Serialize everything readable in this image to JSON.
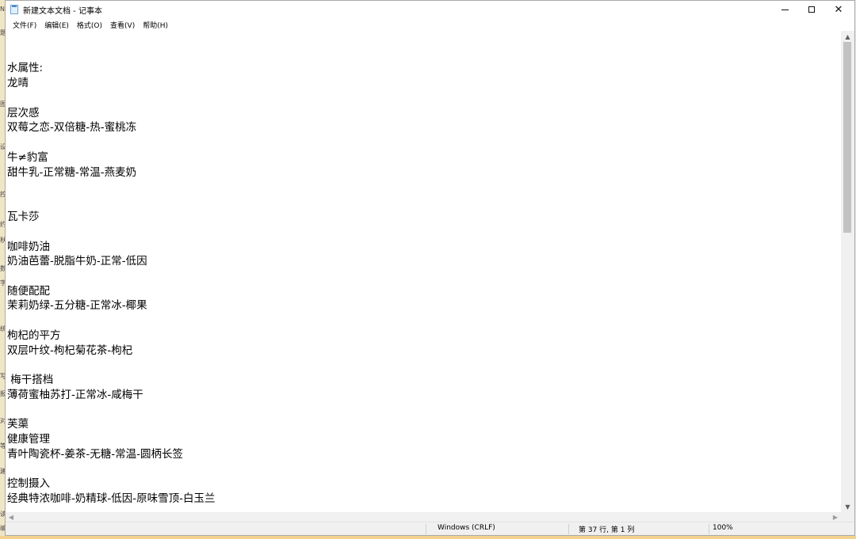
{
  "window": {
    "title": "新建文本文档 - 记事本",
    "min_glyph": "",
    "max_glyph": "",
    "close_glyph": "✕"
  },
  "menu": {
    "file": "文件(F)",
    "edit": "编辑(E)",
    "format": "格式(O)",
    "view": "查看(V)",
    "help": "帮助(H)"
  },
  "document": {
    "lines": [
      "水属性:",
      "龙晴",
      "层次感",
      "双莓之恋-双倍糖-热-蜜桃冻",
      "牛≠豹富",
      "甜牛乳-正常糖-常温-燕麦奶",
      "瓦卡莎",
      "咖啡奶油",
      "奶油芭蕾-脱脂牛奶-正常-低因",
      "随便配配",
      "茉莉奶绿-五分糖-正常冰-椰果",
      "枸杞的平方",
      "双层叶纹-枸杞菊花茶-枸杞",
      " 梅干搭档",
      "薄荷蜜柚苏打-正常冰-咸梅干",
      "芙蕖",
      "健康管理",
      "青叶陶瓷杯-姜茶-无糖-常温-圆柄长签",
      "控制摄入",
      "经典特浓咖啡-奶精球-低因-原味雪顶-白玉兰"
    ]
  },
  "statusbar": {
    "encoding": "Windows (CRLF)",
    "position": "第 37 行, 第 1 列",
    "zoom": "100%"
  },
  "scrollbar": {
    "up_arrow": "▲",
    "down_arrow": "▼",
    "left_arrow": "◀",
    "right_arrow": "▶"
  },
  "background_strip_glyphs": [
    "N",
    "题",
    "图",
    "设",
    "控",
    "约",
    "秋",
    "数",
    "字",
    "统",
    "写",
    "报",
    "对",
    "等",
    "建",
    "读",
    "编"
  ]
}
